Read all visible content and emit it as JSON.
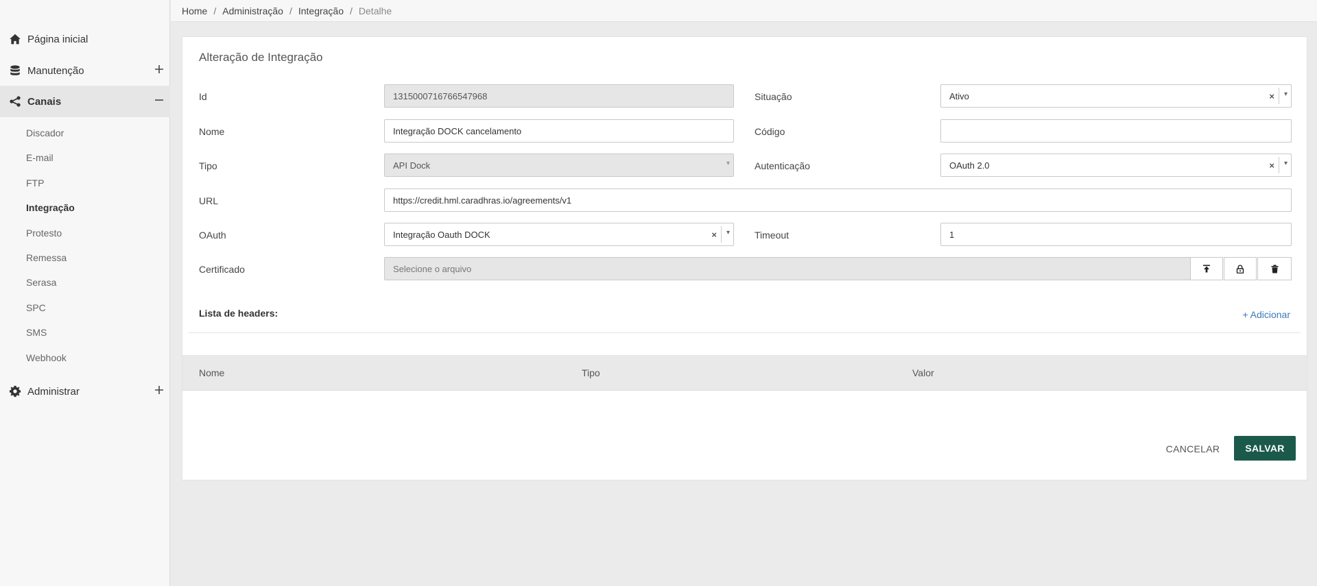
{
  "breadcrumb": {
    "items": [
      "Home",
      "Administração",
      "Integração",
      "Detalhe"
    ],
    "separator": "/"
  },
  "sidebar": {
    "home": {
      "label": "Página inicial",
      "icon": "home-icon"
    },
    "manutencao": {
      "label": "Manutenção",
      "icon": "database-icon",
      "toggle": "+"
    },
    "canais": {
      "label": "Canais",
      "icon": "share-icon",
      "toggle": "−"
    },
    "subitems": [
      "Discador",
      "E-mail",
      "FTP",
      "Integração",
      "Protesto",
      "Remessa",
      "Serasa",
      "SPC",
      "SMS",
      "Webhook"
    ],
    "current_subitem": "Integração",
    "administrar": {
      "label": "Administrar",
      "icon": "gear-icon",
      "toggle": "+"
    }
  },
  "form": {
    "title": "Alteração de Integração",
    "id": {
      "label": "Id",
      "value": "1315000716766547968"
    },
    "situacao": {
      "label": "Situação",
      "value": "Ativo"
    },
    "nome": {
      "label": "Nome",
      "value": "Integração DOCK cancelamento"
    },
    "codigo": {
      "label": "Código",
      "value": ""
    },
    "tipo": {
      "label": "Tipo",
      "value": "API Dock"
    },
    "autenticacao": {
      "label": "Autenticação",
      "value": "OAuth 2.0"
    },
    "url": {
      "label": "URL",
      "value": "https://credit.hml.caradhras.io/agreements/v1"
    },
    "oauth": {
      "label": "OAuth",
      "value": "Integração Oauth DOCK"
    },
    "timeout": {
      "label": "Timeout",
      "value": "1"
    },
    "certificado": {
      "label": "Certificado",
      "placeholder": "Selecione o arquivo"
    },
    "clear_symbol": "×",
    "caret_symbol": "▾"
  },
  "headers": {
    "label": "Lista de headers:",
    "add_label": "+ Adicionar",
    "columns": [
      "Nome",
      "Tipo",
      "Valor"
    ]
  },
  "actions": {
    "cancel_label": "CANCELAR",
    "save_label": "SALVAR"
  },
  "colors": {
    "primary": "#1b5a4b",
    "link": "#3a79b8",
    "sidebar_bg": "#f7f7f7",
    "page_bg": "#ebebeb"
  }
}
